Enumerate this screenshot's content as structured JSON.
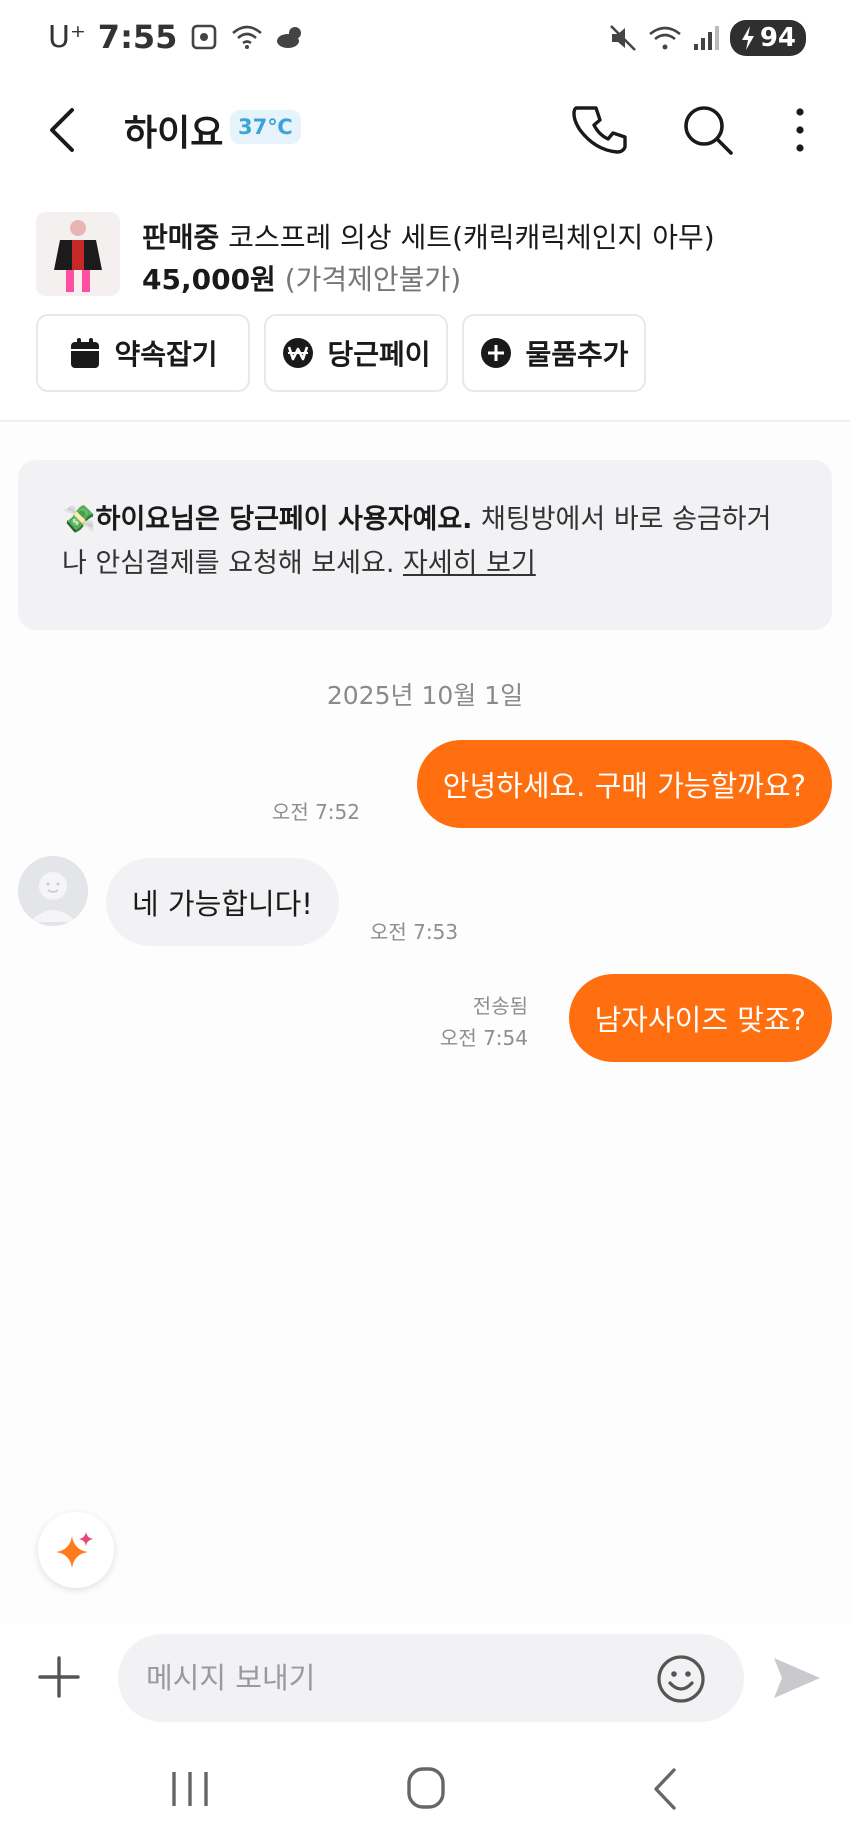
{
  "status_bar": {
    "carrier": "U⁺",
    "time": "7:55",
    "battery": "94",
    "icons": [
      "screenshot-icon",
      "wifi-icon",
      "weather-icon",
      "mute-icon",
      "wifi-signal-icon",
      "cell-signal-icon",
      "charging-icon"
    ]
  },
  "header": {
    "title": "하이요",
    "temperature": "37℃",
    "icons": [
      "back-icon",
      "phone-icon",
      "search-icon",
      "more-icon"
    ]
  },
  "product": {
    "status": "판매중",
    "title": " 코스프레 의상 세트(캐릭캐릭체인지 아무)",
    "price": "45,000원",
    "negotiation": " (가격제안불가)",
    "actions": [
      {
        "label": "약속잡기",
        "icon": "calendar-icon"
      },
      {
        "label": "당근페이",
        "icon": "won-icon"
      },
      {
        "label": "물품추가",
        "icon": "plus-circle-icon"
      }
    ]
  },
  "notice": {
    "emoji": "💸",
    "bold": "하이요님은 당근페이 사용자예요.",
    "text": " 채팅방에서 바로 송금하거나 안심결제를 요청해 보세요. ",
    "link": "자세히 보기"
  },
  "chat": {
    "date": "2025년 10월 1일",
    "messages": [
      {
        "direction": "out",
        "text": "안녕하세요. 구매 가능할까요?",
        "time": "오전 7:52"
      },
      {
        "direction": "in",
        "text": "네 가능합니다!",
        "time": "오전 7:53"
      },
      {
        "direction": "out",
        "text": "남자사이즈 맞죠?",
        "time": "오전 7:54",
        "status": "전송됨"
      }
    ]
  },
  "input": {
    "placeholder": "메시지 보내기",
    "value": ""
  },
  "colors": {
    "accent": "#ff6f0f",
    "incoming_bubble": "#f2f2f4",
    "temperature": "#3aa3d8"
  },
  "nav": [
    "recent-apps-icon",
    "home-icon",
    "back-nav-icon"
  ]
}
